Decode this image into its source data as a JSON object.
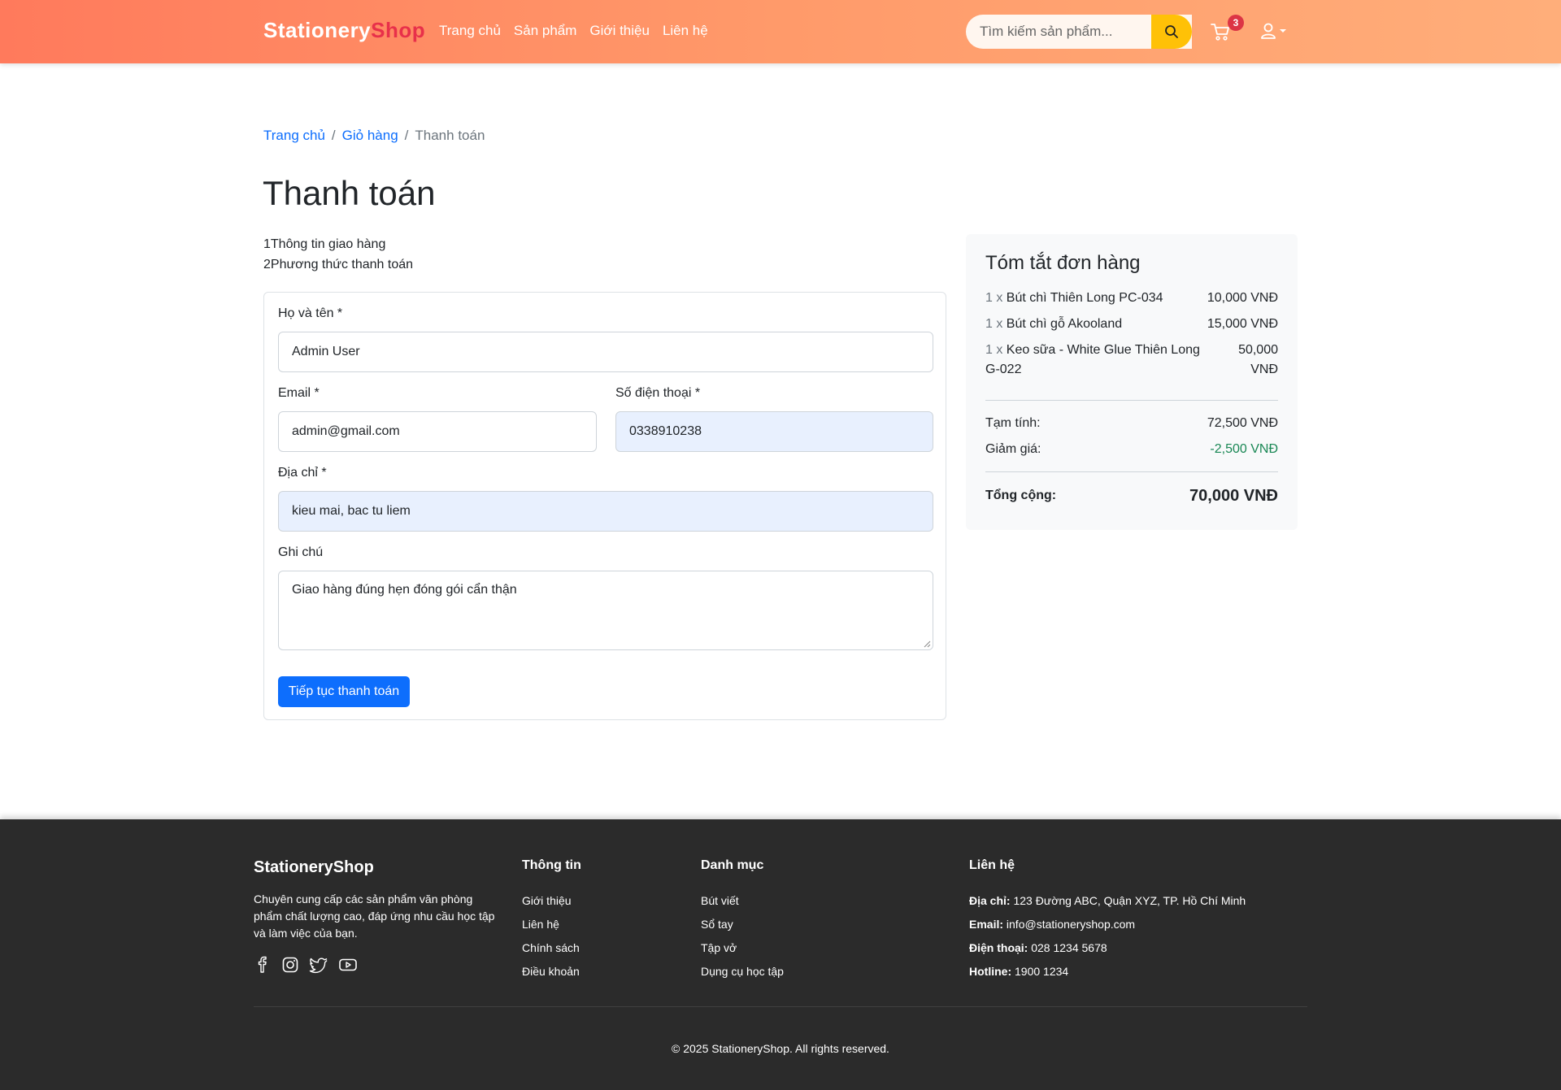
{
  "header": {
    "brand_part1": "Stationery",
    "brand_part2": "Shop",
    "nav": [
      "Trang chủ",
      "Sản phẩm",
      "Giới thiệu",
      "Liên hệ"
    ],
    "search_placeholder": "Tìm kiếm sản phẩm...",
    "cart_count": "3"
  },
  "breadcrumb": {
    "home": "Trang chủ",
    "cart": "Giỏ hàng",
    "current": "Thanh toán",
    "separator": "/"
  },
  "page_title": "Thanh toán",
  "steps": [
    "1Thông tin giao hàng",
    "2Phương thức thanh toán"
  ],
  "form": {
    "name_label": "Họ và tên *",
    "name_value": "Admin User",
    "email_label": "Email *",
    "email_value": "admin@gmail.com",
    "phone_label": "Số điện thoại *",
    "phone_value": "0338910238",
    "address_label": "Địa chỉ *",
    "address_value": "kieu mai, bac tu liem",
    "note_label": "Ghi chú",
    "note_value": "Giao hàng đúng hẹn đóng gói cẩn thận",
    "submit_label": "Tiếp tục thanh toán"
  },
  "summary": {
    "title": "Tóm tắt đơn hàng",
    "items": [
      {
        "qty": "1 x",
        "name": "Bút chì Thiên Long PC-034",
        "price": "10,000 VNĐ"
      },
      {
        "qty": "1 x",
        "name": "Bút chì gỗ Akooland",
        "price": "15,000 VNĐ"
      },
      {
        "qty": "1 x",
        "name": "Keo sữa - White Glue Thiên Long G-022",
        "price_line1": "50,000",
        "price_line2": "VNĐ"
      }
    ],
    "subtotal_label": "Tạm tính:",
    "subtotal_value": "72,500 VNĐ",
    "discount_label": "Giảm giá:",
    "discount_value": "-2,500 VNĐ",
    "total_label": "Tổng cộng:",
    "total_value": "70,000 VNĐ"
  },
  "footer": {
    "brand": "StationeryShop",
    "description": "Chuyên cung cấp các sản phẩm văn phòng phẩm chất lượng cao, đáp ứng nhu cầu học tập và làm việc của bạn.",
    "info_title": "Thông tin",
    "info_links": [
      "Giới thiệu",
      "Liên hệ",
      "Chính sách",
      "Điều khoản"
    ],
    "category_title": "Danh mục",
    "category_links": [
      "Bút viết",
      "Sổ tay",
      "Tập vở",
      "Dụng cụ học tập"
    ],
    "contact_title": "Liên hệ",
    "address_label": "Địa chỉ:",
    "address_value": "123 Đường ABC, Quận XYZ, TP. Hồ Chí Minh",
    "email_label": "Email:",
    "email_value": "info@stationeryshop.com",
    "phone_label": "Điện thoại:",
    "phone_value": "028 1234 5678",
    "hotline_label": "Hotline:",
    "hotline_value": "1900 1234",
    "copyright": "© 2025 StationeryShop. All rights reserved."
  },
  "colors": {
    "header_start": "#ff7a5c",
    "header_end": "#ffae7a",
    "brand_accent": "#e8304a",
    "primary": "#0d6efd",
    "search_button": "#ffc107",
    "badge": "#dc3545",
    "discount": "#198754",
    "footer_bg": "#2b2b2b"
  },
  "icons": {
    "search": "search-icon",
    "cart": "cart-icon",
    "user": "user-icon",
    "socials": [
      "facebook-icon",
      "instagram-icon",
      "twitter-icon",
      "youtube-icon"
    ]
  }
}
